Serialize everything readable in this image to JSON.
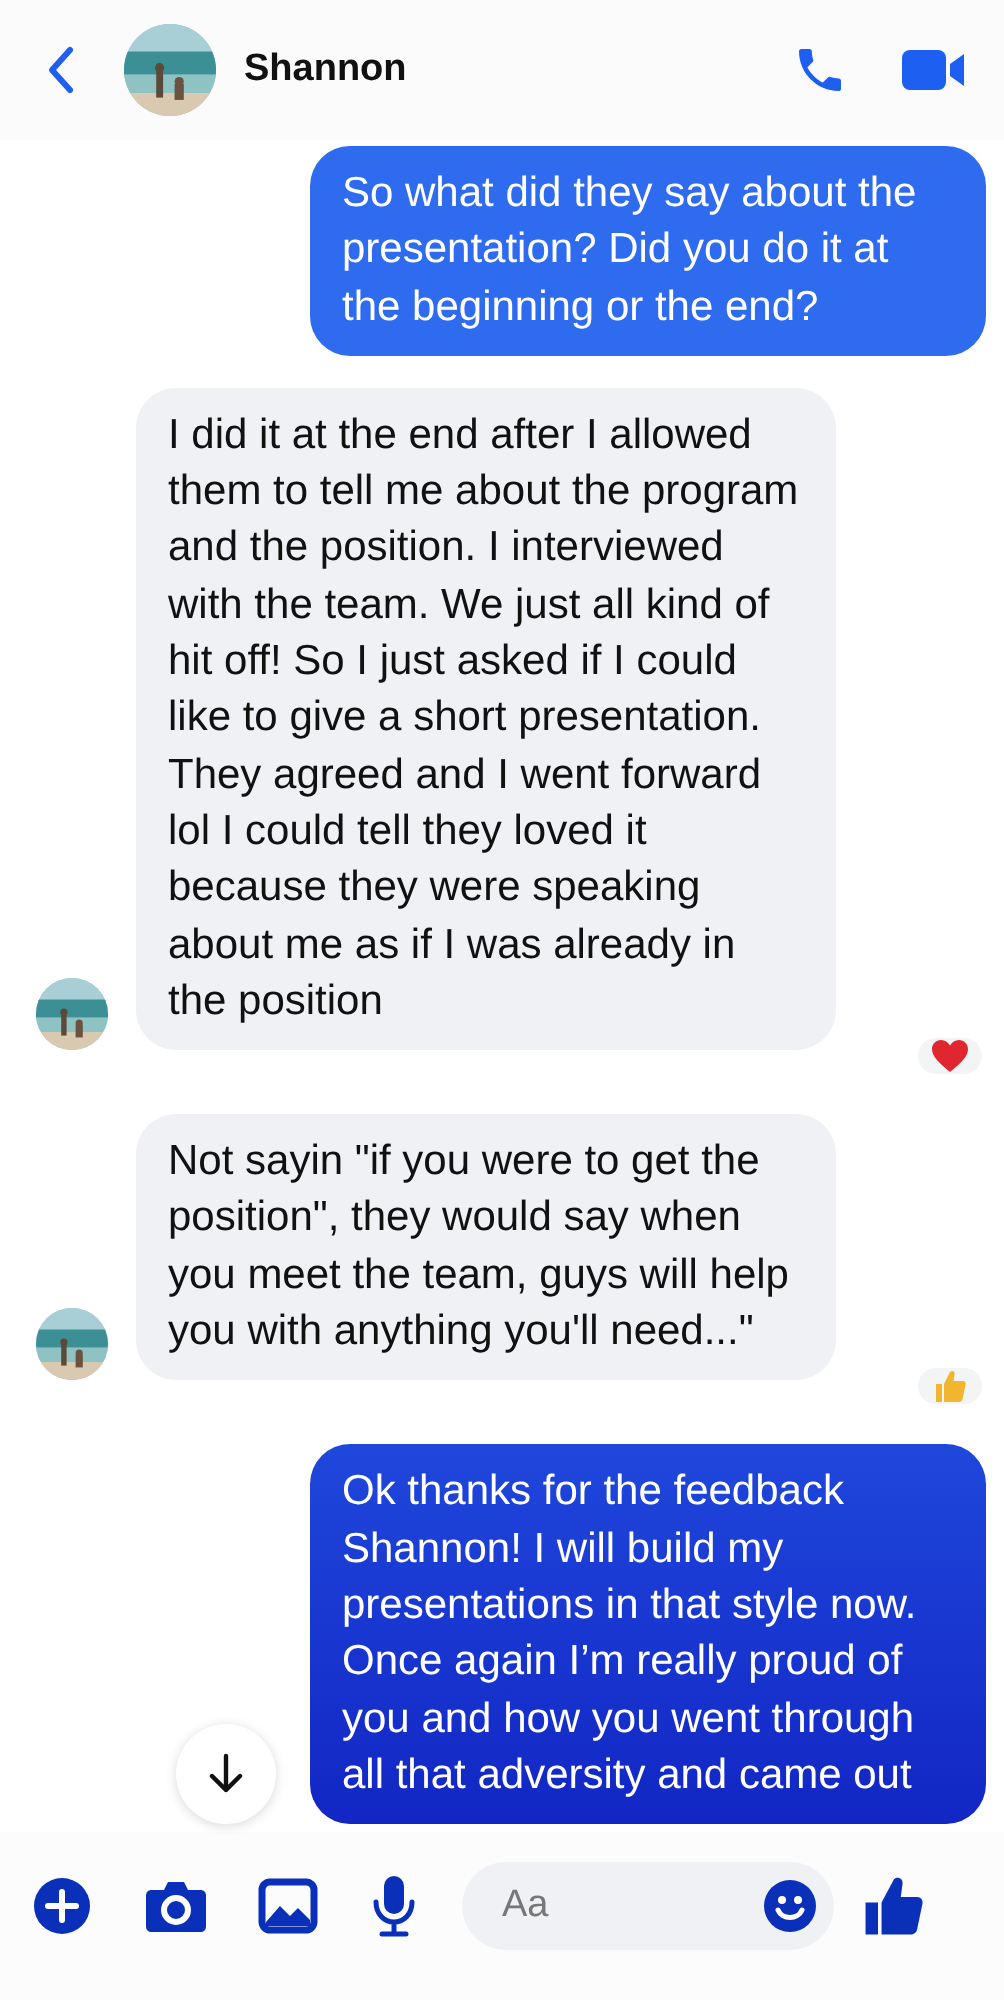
{
  "header": {
    "name": "Shannon"
  },
  "messages": [
    {
      "kind": "sent",
      "text": "So what did they say about the presentation? Did you do it at the beginning or the end?"
    },
    {
      "kind": "received",
      "avatar": true,
      "reaction": {
        "kind": "heart"
      },
      "text": "I did it at the end after I allowed them to tell me about the program and the position. I interviewed with the team. We just all kind of hit off! So I just asked if I could like to give a short presentation. They agreed and I went forward lol I could tell they loved it because they were speaking about me as if I was already in the position"
    },
    {
      "kind": "received",
      "avatar": true,
      "reaction": {
        "kind": "like"
      },
      "text": "Not sayin \"if you were to get the position\", they would say when you meet the team, guys will help you with anything you'll need...\""
    },
    {
      "kind": "sent",
      "text": "Ok thanks for the feedback Shannon! I will build my presentations in that style now. Once again I’m really proud of you and how you went through all that adversity and came out"
    }
  ],
  "composer": {
    "placeholder": "Aa"
  }
}
